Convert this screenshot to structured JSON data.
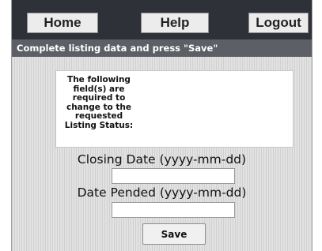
{
  "nav": {
    "home_label": "Home",
    "help_label": "Help",
    "logout_label": "Logout"
  },
  "instruction": "Complete listing data and press \"Save\"",
  "notice": {
    "text": "The following field(s) are required to change to the requested Listing Status:"
  },
  "fields": {
    "closing_date": {
      "label": "Closing Date (yyyy-mm-dd)",
      "value": ""
    },
    "date_pended": {
      "label": "Date Pended (yyyy-mm-dd)",
      "value": ""
    }
  },
  "save_label": "Save",
  "colors": {
    "navbar": "#2f3138",
    "instruction_bar": "#5c5f66",
    "background": "#d8d8d8"
  }
}
